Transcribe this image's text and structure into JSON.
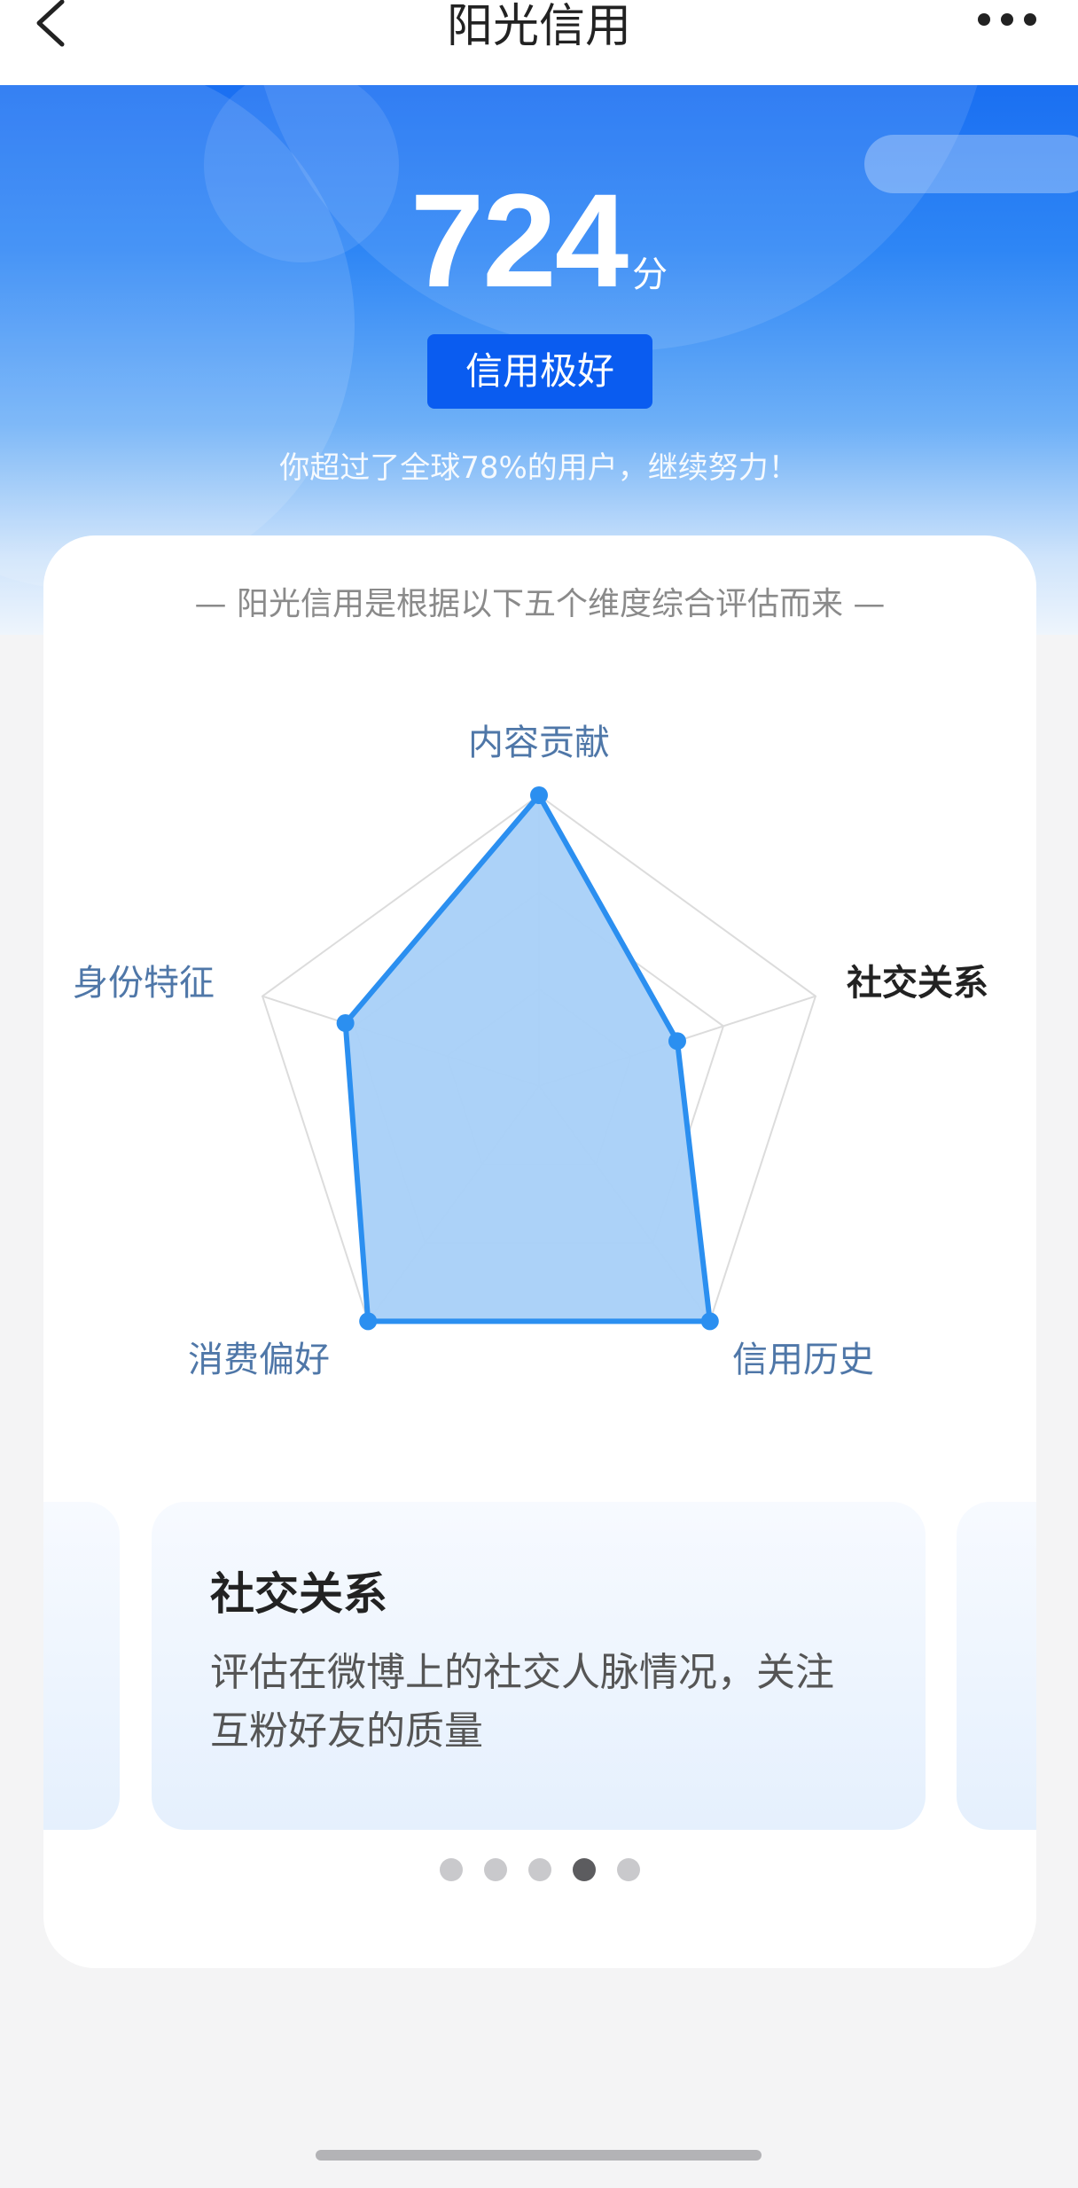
{
  "nav": {
    "title": "阳光信用",
    "back_icon": "chevron-left-icon",
    "more_icon": "ellipsis-icon"
  },
  "hero": {
    "score": "724",
    "score_unit": "分",
    "grade": "信用极好",
    "subtitle": "你超过了全球78%的用户，继续努力！"
  },
  "card": {
    "intro": "— 阳光信用是根据以下五个维度综合评估而来 —",
    "radar": {
      "dimensions": [
        "内容贡献",
        "社交关系",
        "信用历史",
        "消费偏好",
        "身份特征"
      ],
      "values": [
        1.0,
        0.5,
        1.0,
        1.0,
        0.7
      ],
      "selected": "社交关系"
    },
    "carousel": {
      "current": {
        "title": "社交关系",
        "text": "评估在微博上的社交人脉情况，关注互粉好友的质量"
      },
      "dots": 5,
      "active_index": 3
    }
  },
  "colors": {
    "accent": "#2b8ff0",
    "radar_fill": "#a8d0f8",
    "hero_top": "#1a6ff2",
    "badge": "#0a5cf0"
  }
}
